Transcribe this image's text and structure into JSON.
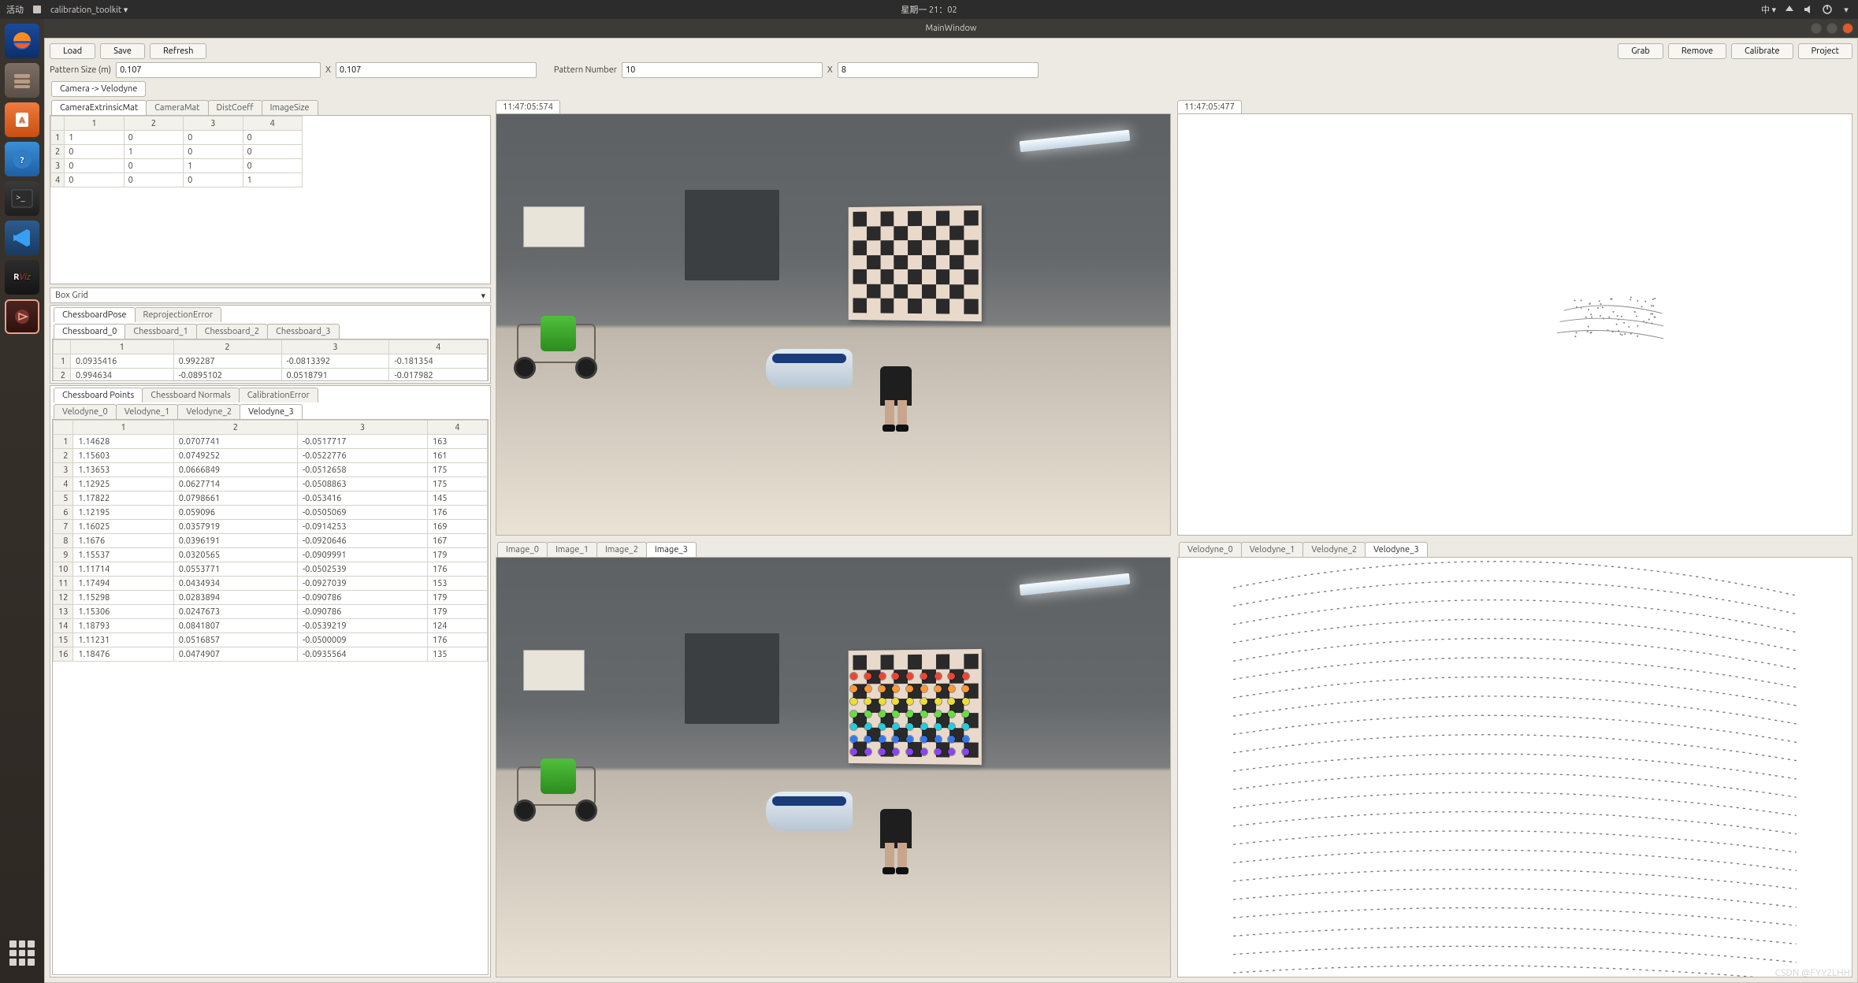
{
  "topbar": {
    "activities": "活动",
    "app_menu": "calibration_toolkit ▾",
    "clock": "星期一  21：02",
    "ime": "中 ▾"
  },
  "titlebar": {
    "title": "MainWindow"
  },
  "launcher": {
    "icons": [
      "firefox",
      "files",
      "software",
      "help",
      "terminal",
      "vscode",
      "rviz",
      "app"
    ]
  },
  "toolbar": {
    "load": "Load",
    "save": "Save",
    "refresh": "Refresh",
    "grab": "Grab",
    "remove": "Remove",
    "calibrate": "Calibrate",
    "project": "Project"
  },
  "pattern": {
    "size_label": "Pattern Size (m)",
    "size_val": "0.107",
    "x_label": "X",
    "size_val2": "0.107",
    "num_label": "Pattern Number",
    "num_val": "10",
    "num_val2": "8"
  },
  "maintab": "Camera -> Velodyne",
  "mat_tabs": [
    "CameraExtrinsicMat",
    "CameraMat",
    "DistCoeff",
    "ImageSize"
  ],
  "mat_headers": [
    "1",
    "2",
    "3",
    "4"
  ],
  "mat_rows": [
    [
      "1",
      "0",
      "0",
      "0"
    ],
    [
      "0",
      "1",
      "0",
      "0"
    ],
    [
      "0",
      "0",
      "1",
      "0"
    ],
    [
      "0",
      "0",
      "0",
      "1"
    ]
  ],
  "box_grid": "Box Grid",
  "pose_tabs": [
    "ChessboardPose",
    "ReprojectionError"
  ],
  "chessboards": [
    "Chessboard_0",
    "Chessboard_1",
    "Chessboard_2",
    "Chessboard_3"
  ],
  "pose_headers": [
    "1",
    "2",
    "3",
    "4"
  ],
  "pose_rows": [
    [
      "0.0935416",
      "0.992287",
      "-0.0813392",
      "-0.181354"
    ],
    [
      "0.994634",
      "-0.0895102",
      "0.0518791",
      "-0.017982"
    ]
  ],
  "calib_tabs": [
    "Chessboard Points",
    "Chessboard Normals",
    "CalibrationError"
  ],
  "velodynes": [
    "Velodyne_0",
    "Velodyne_1",
    "Velodyne_2",
    "Velodyne_3"
  ],
  "vel_headers": [
    "1",
    "2",
    "3",
    "4"
  ],
  "vel_rows": [
    [
      "1.14628",
      "0.0707741",
      "-0.0517717",
      "163"
    ],
    [
      "1.15603",
      "0.0749252",
      "-0.0522776",
      "161"
    ],
    [
      "1.13653",
      "0.0666849",
      "-0.0512658",
      "175"
    ],
    [
      "1.12925",
      "0.0627714",
      "-0.0508863",
      "175"
    ],
    [
      "1.17822",
      "0.0798661",
      "-0.053416",
      "145"
    ],
    [
      "1.12195",
      "0.059096",
      "-0.0505069",
      "176"
    ],
    [
      "1.16025",
      "0.0357919",
      "-0.0914253",
      "169"
    ],
    [
      "1.1676",
      "0.0396191",
      "-0.0920646",
      "167"
    ],
    [
      "1.15537",
      "0.0320565",
      "-0.0909991",
      "179"
    ],
    [
      "1.11714",
      "0.0553771",
      "-0.0502539",
      "176"
    ],
    [
      "1.17494",
      "0.0434934",
      "-0.0927039",
      "153"
    ],
    [
      "1.15298",
      "0.0283894",
      "-0.090786",
      "179"
    ],
    [
      "1.15306",
      "0.0247673",
      "-0.090786",
      "179"
    ],
    [
      "1.18793",
      "0.0841807",
      "-0.0539219",
      "124"
    ],
    [
      "1.11231",
      "0.0516857",
      "-0.0500009",
      "176"
    ],
    [
      "1.18476",
      "0.0474907",
      "-0.0935564",
      "135"
    ]
  ],
  "timestamps": {
    "cam": "11:47:05:574",
    "lidar_top": "11:47:05:477"
  },
  "image_tabs": [
    "Image_0",
    "Image_1",
    "Image_2",
    "Image_3"
  ],
  "lidar_tabs": [
    "Velodyne_0",
    "Velodyne_1",
    "Velodyne_2",
    "Velodyne_3"
  ],
  "watermark": "CSDN @FYY2LHH"
}
